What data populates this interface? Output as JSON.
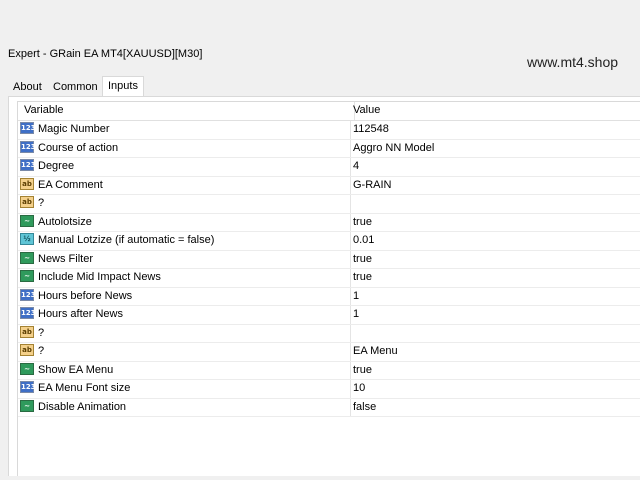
{
  "window": {
    "title": "Expert - GRain EA MT4[XAUUSD][M30]"
  },
  "watermark": "www.mt4.shop",
  "tabs": [
    {
      "label": "About"
    },
    {
      "label": "Common"
    },
    {
      "label": "Inputs",
      "active": true
    }
  ],
  "table": {
    "headers": {
      "variable": "Variable",
      "value": "Value"
    },
    "rows": [
      {
        "icon": "int-icon",
        "glyph": "123",
        "variable": "Magic Number",
        "value": "112548"
      },
      {
        "icon": "int-icon",
        "glyph": "123",
        "variable": "Course of action",
        "value": "Aggro NN Model"
      },
      {
        "icon": "int-icon",
        "glyph": "123",
        "variable": "Degree",
        "value": "4"
      },
      {
        "icon": "str-icon",
        "glyph": "ab",
        "variable": "EA Comment",
        "value": "G-RAIN"
      },
      {
        "icon": "str-icon",
        "glyph": "ab",
        "variable": "?",
        "value": ""
      },
      {
        "icon": "bool-icon",
        "glyph": "~",
        "variable": "Autolotsize",
        "value": "true"
      },
      {
        "icon": "dbl-icon",
        "glyph": "½",
        "variable": "Manual Lotzize (if automatic = false)",
        "value": "0.01"
      },
      {
        "icon": "bool-icon",
        "glyph": "~",
        "variable": "News Filter",
        "value": "true"
      },
      {
        "icon": "bool-icon",
        "glyph": "~",
        "variable": "Include Mid Impact News",
        "value": "true"
      },
      {
        "icon": "int-icon",
        "glyph": "123",
        "variable": "Hours before News",
        "value": "1"
      },
      {
        "icon": "int-icon",
        "glyph": "123",
        "variable": "Hours after News",
        "value": "1"
      },
      {
        "icon": "str-icon",
        "glyph": "ab",
        "variable": "?",
        "value": ""
      },
      {
        "icon": "str-icon",
        "glyph": "ab",
        "variable": "?",
        "value": "EA Menu"
      },
      {
        "icon": "bool-icon",
        "glyph": "~",
        "variable": "Show EA Menu",
        "value": "true"
      },
      {
        "icon": "int-icon",
        "glyph": "123",
        "variable": "EA Menu Font size",
        "value": "10"
      },
      {
        "icon": "bool-icon",
        "glyph": "~",
        "variable": "Disable Animation",
        "value": "false"
      }
    ]
  }
}
